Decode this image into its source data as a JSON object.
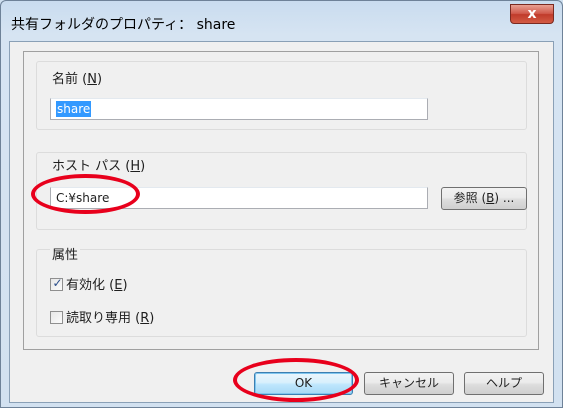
{
  "window": {
    "title": "共有フォルダのプロパティ： share",
    "close_symbol": "x"
  },
  "name_group": {
    "label": "名前 (",
    "accel": "N",
    "label_end": ")",
    "value": "share"
  },
  "host_path_group": {
    "label": "ホスト パス (",
    "accel": "H",
    "label_end": ")",
    "value": "C:¥share",
    "browse_label": "参照 (",
    "browse_accel": "B",
    "browse_end": ") ..."
  },
  "attributes_group": {
    "label": "属性",
    "enabled_label": "有効化 (",
    "enabled_accel": "E",
    "enabled_end": ")",
    "enabled_checked": true,
    "readonly_label": "読取り専用 (",
    "readonly_accel": "R",
    "readonly_end": ")",
    "readonly_checked": false
  },
  "buttons": {
    "ok": "OK",
    "cancel": "キャンセル",
    "help": "ヘルプ"
  },
  "colors": {
    "annotation": "#e8001c",
    "selection": "#3399ff"
  }
}
